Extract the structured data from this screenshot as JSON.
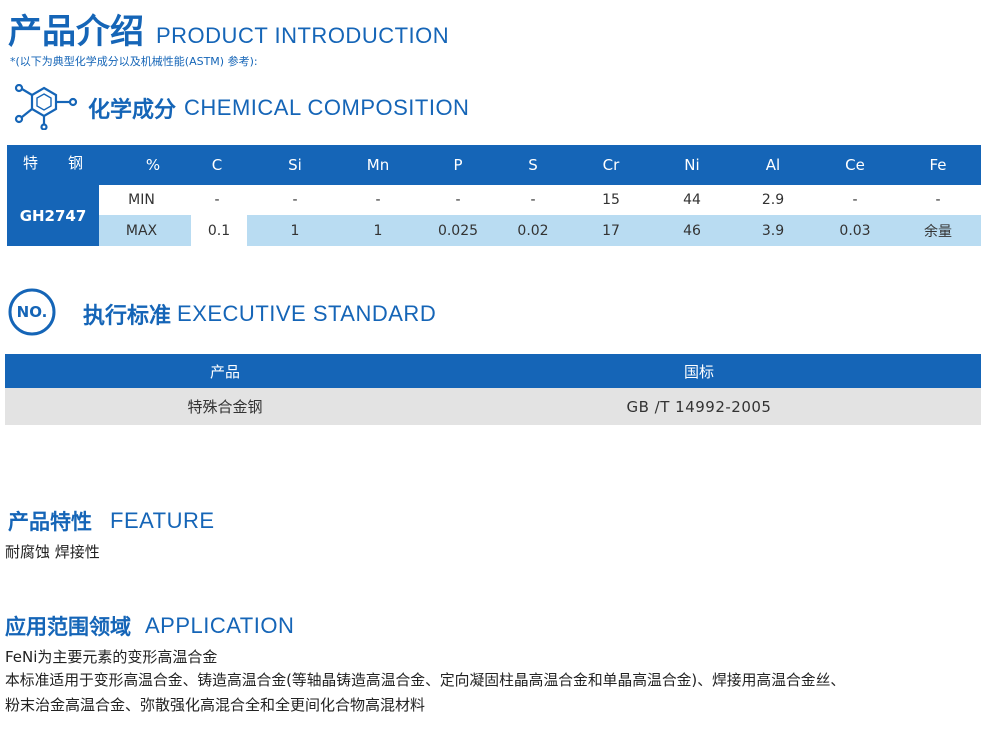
{
  "intro": {
    "title_cn": "产品介绍",
    "title_en": "PRODUCT INTRODUCTION",
    "note": "*(以下为典型化学成分以及机械性能(ASTM) 参考):"
  },
  "chemical": {
    "title_cn": "化学成分",
    "title_en": "CHEMICAL COMPOSITION",
    "head_label": "特　　钢",
    "pct_label": "%",
    "grade": "GH2747",
    "elements": [
      "C",
      "Si",
      "Mn",
      "P",
      "S",
      "Cr",
      "Ni",
      "Al",
      "Ce",
      "Fe"
    ],
    "min_label": "MIN",
    "max_label": "MAX",
    "min": [
      "-",
      "-",
      "-",
      "-",
      "-",
      "15",
      "44",
      "2.9",
      "-",
      "-"
    ],
    "max": [
      "0.1",
      "1",
      "1",
      "0.025",
      "0.02",
      "17",
      "46",
      "3.9",
      "0.03",
      "余量"
    ]
  },
  "standard": {
    "title_cn": "执行标准",
    "title_en": "EXECUTIVE STANDARD",
    "badge": "NO.",
    "headers": [
      "产品",
      "国标"
    ],
    "row": [
      "特殊合金钢",
      "GB /T 14992-2005"
    ]
  },
  "feature": {
    "title_cn": "产品特性",
    "title_en": "FEATURE",
    "text": "耐腐蚀 焊接性"
  },
  "application": {
    "title_cn": "应用范围领域",
    "title_en": "APPLICATION",
    "lines": [
      "FeNi为主要元素的变形高温合金",
      "本标准适用于变形高温合金、铸造高温合金(等轴晶铸造高温合金、定向凝固柱晶高温合金和单晶高温合金)、焊接用高温合金丝、",
      "粉末治金高温合金、弥散强化高混合全和全更间化合物高混材料"
    ]
  },
  "colors": {
    "primary": "#1565b7",
    "light_blue": "#b9dcf2",
    "gray_row": "#e3e3e3"
  }
}
